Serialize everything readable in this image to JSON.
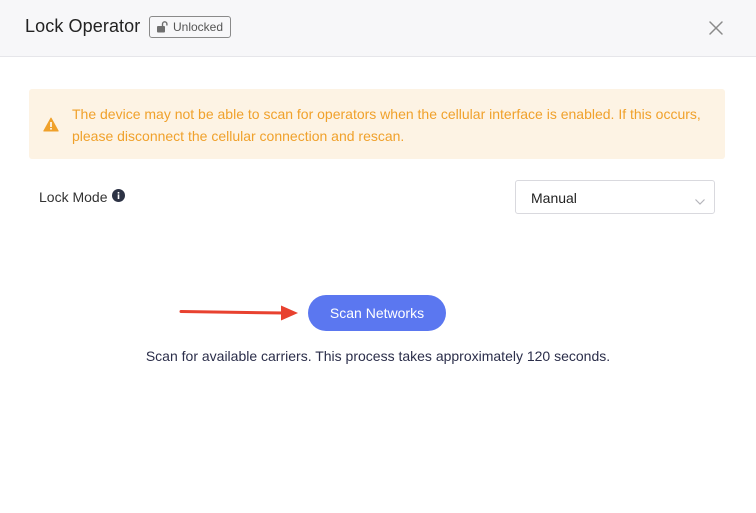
{
  "dialog": {
    "title": "Lock Operator",
    "badge": {
      "label": "Unlocked",
      "icon": "unlock-icon"
    },
    "close_icon": "close-icon"
  },
  "alert": {
    "icon": "warning-icon",
    "text": "The device may not be able to scan for operators when the cellular interface is enabled. If this occurs, please disconnect the cellular connection and rescan."
  },
  "lock_mode": {
    "label": "Lock Mode",
    "info_icon": "info-icon",
    "selected": "Manual"
  },
  "scan": {
    "button_label": "Scan Networks",
    "hint": "Scan for available carriers. This process takes approximately 120 seconds."
  },
  "colors": {
    "accent": "#5b77f0",
    "warning_text": "#f0a12b",
    "warning_bg": "#fdf3e4",
    "annotation_arrow": "#e8412f"
  }
}
